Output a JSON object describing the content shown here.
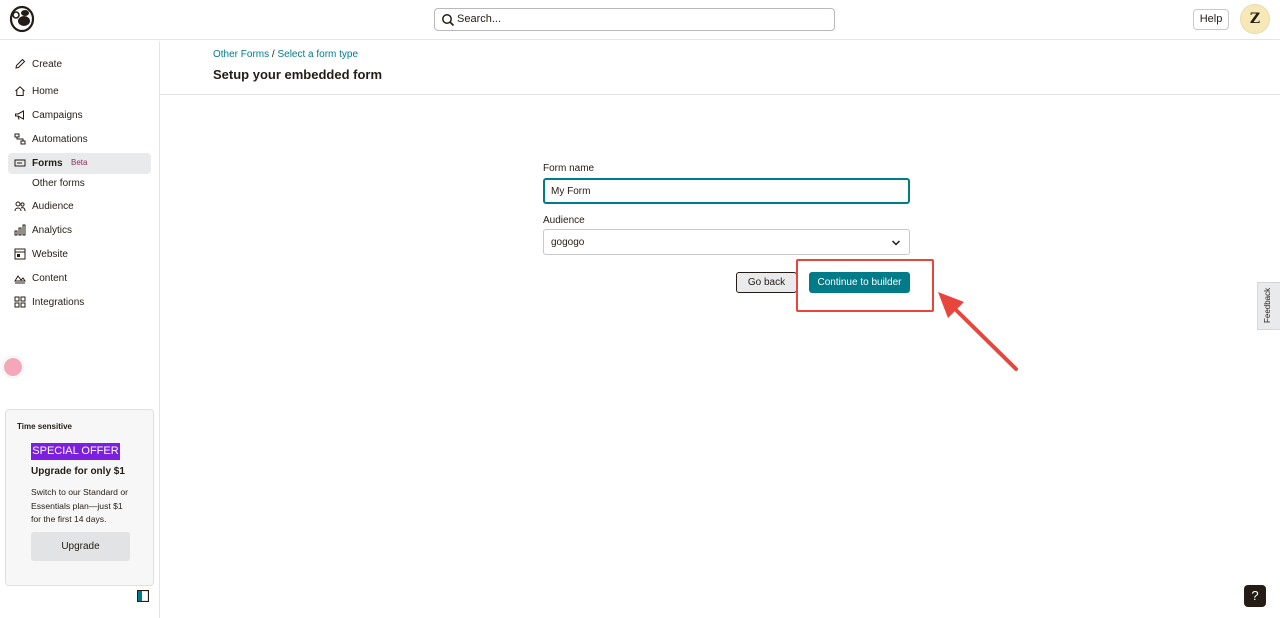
{
  "header": {
    "search_placeholder": "Search...",
    "help_label": "Help",
    "avatar_initial": "Z"
  },
  "sidebar": {
    "items": [
      {
        "label": "Create",
        "icon": "pencil-icon"
      },
      {
        "label": "Home",
        "icon": "home-icon"
      },
      {
        "label": "Campaigns",
        "icon": "megaphone-icon"
      },
      {
        "label": "Automations",
        "icon": "flow-icon"
      },
      {
        "label": "Forms",
        "icon": "form-icon",
        "badge": "Beta",
        "active": true
      },
      {
        "label": "Audience",
        "icon": "audience-icon"
      },
      {
        "label": "Analytics",
        "icon": "bar-chart-icon"
      },
      {
        "label": "Website",
        "icon": "website-icon"
      },
      {
        "label": "Content",
        "icon": "content-icon"
      },
      {
        "label": "Integrations",
        "icon": "grid-icon"
      }
    ],
    "subitem": "Other forms",
    "promo": {
      "time_sensitive": "Time sensitive",
      "badge": "SPECIAL OFFER",
      "title": "Upgrade for only $1",
      "text": "Switch to our Standard or Essentials plan—just $1 for the first 14 days.",
      "button": "Upgrade"
    }
  },
  "main": {
    "breadcrumb": {
      "first": "Other Forms",
      "separator": "/",
      "second": "Select a form type"
    },
    "title": "Setup your embedded form",
    "form": {
      "name_label": "Form name",
      "name_value": "My Form",
      "audience_label": "Audience",
      "audience_value": "gogogo"
    },
    "buttons": {
      "back": "Go back",
      "continue": "Continue to builder"
    }
  },
  "feedback_label": "Feedback",
  "help_question": "?",
  "colors": {
    "accent": "#007c89",
    "promo_purple": "#7c1fde",
    "annotation_red": "#e8453c"
  }
}
